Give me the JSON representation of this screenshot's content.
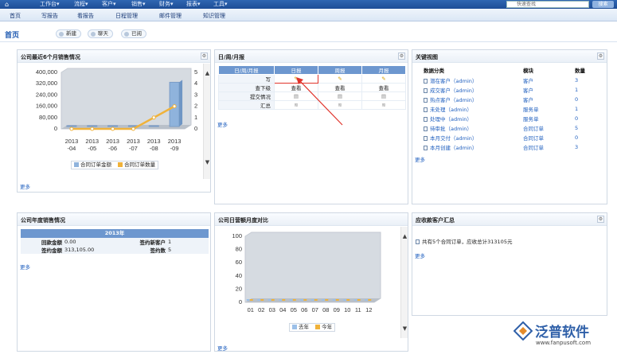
{
  "topbar": {
    "menus": [
      "工作台▾",
      "流程▾",
      "客户▾",
      "销售▾",
      "财务▾",
      "报表▾",
      "工具▾"
    ],
    "search_placeholder": "快速查找",
    "search_button": "搜索"
  },
  "nav": {
    "items": [
      "首页",
      "写报告",
      "看报告",
      "日程管理",
      "邮件管理",
      "知识管理"
    ]
  },
  "page": {
    "title": "首页",
    "buttons": [
      "新建",
      "聊天",
      "已阅"
    ]
  },
  "panels": {
    "sales6": {
      "title": "公司最近6个月销售情况",
      "more": "更多",
      "chart_data": {
        "type": "bar+line",
        "categories": [
          "2013-04",
          "2013-05",
          "2013-06",
          "2013-07",
          "2013-08",
          "2013-09"
        ],
        "category_labels_top": [
          "2013",
          "2013",
          "2013",
          "2013",
          "2013",
          "2013"
        ],
        "category_labels_bottom": [
          "-04",
          "-05",
          "-06",
          "-07",
          "-08",
          "-09"
        ],
        "series": [
          {
            "name": "合同订单金额",
            "type": "bar",
            "values": [
              0,
              0,
              0,
              0,
              0,
              313105
            ]
          },
          {
            "name": "合同订单数量",
            "type": "line",
            "values": [
              0,
              0,
              0,
              0,
              1,
              2
            ]
          }
        ],
        "y_left_ticks": [
          "400,000",
          "320,000",
          "240,000",
          "160,000",
          "80,000",
          "0"
        ],
        "y_right_ticks": [
          "5",
          "4",
          "3",
          "2",
          "1",
          "0"
        ],
        "ylim_left": [
          0,
          400000
        ],
        "ylim_right": [
          0,
          5
        ],
        "colors": {
          "bar": "#8fb3dc",
          "line": "#f0b23a"
        }
      }
    },
    "daily": {
      "title": "日/周/月报",
      "more": "更多",
      "headers": [
        "日/周/月报",
        "日报",
        "周报",
        "月报"
      ],
      "rows": [
        {
          "label": "写",
          "cells": [
            "✎",
            "✎",
            "✎"
          ]
        },
        {
          "label": "查下级",
          "cells": [
            "查看",
            "查看",
            "查看"
          ]
        },
        {
          "label": "提交情况",
          "cells": [
            "▤",
            "▤",
            "▤"
          ]
        },
        {
          "label": "汇总",
          "cells": [
            "≋",
            "≋",
            "≋"
          ]
        }
      ]
    },
    "key": {
      "title": "关键视图",
      "more": "更多",
      "headers": [
        "数据分类",
        "模块",
        "数量"
      ],
      "rows": [
        {
          "name": "潜在客户（admin）",
          "module": "客户",
          "count": "3"
        },
        {
          "name": "成交客户（admin）",
          "module": "客户",
          "count": "1"
        },
        {
          "name": "热点客户（admin）",
          "module": "客户",
          "count": "0"
        },
        {
          "name": "未处理（admin）",
          "module": "服务单",
          "count": "1"
        },
        {
          "name": "处理中（admin）",
          "module": "服务单",
          "count": "0"
        },
        {
          "name": "待审批（admin）",
          "module": "合同订单",
          "count": "5"
        },
        {
          "name": "本月交付（admin）",
          "module": "合同订单",
          "count": "0"
        },
        {
          "name": "本月创建（admin）",
          "module": "合同订单",
          "count": "3"
        }
      ]
    },
    "yearly": {
      "title": "公司年度销售情况",
      "more": "更多",
      "year": "2013年",
      "rows": [
        {
          "k1": "回款金额",
          "v1": "0.00",
          "k2": "签约新客户",
          "v2": "1"
        },
        {
          "k1": "签约金额",
          "v1": "313,105.00",
          "k2": "签约数",
          "v2": "5"
        }
      ]
    },
    "cumulative": {
      "title": "公司日营额月度对比",
      "more": "更多",
      "chart_data": {
        "type": "bar",
        "categories": [
          "01",
          "02",
          "03",
          "04",
          "05",
          "06",
          "07",
          "08",
          "09",
          "10",
          "11",
          "12"
        ],
        "series": [
          {
            "name": "去年",
            "values": [
              0,
              0,
              0,
              0,
              0,
              0,
              0,
              0,
              0,
              0,
              0,
              0
            ]
          },
          {
            "name": "今年",
            "values": [
              0,
              0,
              0,
              0,
              0,
              0,
              0,
              0,
              0,
              0,
              0,
              0
            ]
          }
        ],
        "y_ticks": [
          "100",
          "80",
          "60",
          "40",
          "20",
          "0"
        ],
        "ylim": [
          0,
          100
        ],
        "colors": {
          "s1": "#9cc0e8",
          "s2": "#f0b23a"
        }
      }
    },
    "receivable": {
      "title": "应收款客户汇总",
      "more": "更多",
      "text": "共有5个合同订单，应收总计313105元"
    }
  },
  "logo": {
    "name": "泛普软件",
    "url": "www.fanpusoft.com"
  }
}
